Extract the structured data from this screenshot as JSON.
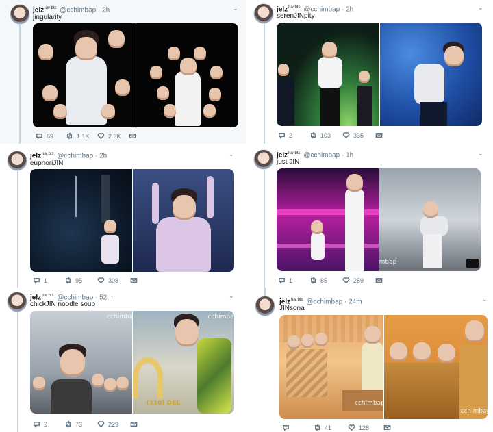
{
  "tweets": [
    {
      "name": "jelz",
      "badge": "luv bts",
      "handle": "@cchimbap",
      "dot": "·",
      "time": "2h",
      "text": "jingularity",
      "replies": "69",
      "retweets": "1.1K",
      "likes": "2.3K"
    },
    {
      "name": "jelz",
      "badge": "luv bts",
      "handle": "@cchimbap",
      "dot": "·",
      "time": "2h",
      "text": "serenJINpity",
      "replies": "2",
      "retweets": "103",
      "likes": "335"
    },
    {
      "name": "jelz",
      "badge": "luv bts",
      "handle": "@cchimbap",
      "dot": "·",
      "time": "2h",
      "text": "euphoriJIN",
      "replies": "1",
      "retweets": "95",
      "likes": "308"
    },
    {
      "name": "jelz",
      "badge": "luv bts",
      "handle": "@cchimbap",
      "dot": "·",
      "time": "1h",
      "text": "just JIN",
      "replies": "1",
      "retweets": "85",
      "likes": "259"
    },
    {
      "name": "jelz",
      "badge": "luv bts",
      "handle": "@cchimbap",
      "dot": "·",
      "time": "52m",
      "text": "chickJIN noodle soup",
      "replies": "2",
      "retweets": "73",
      "likes": "229"
    },
    {
      "name": "jelz",
      "badge": "luv bts",
      "handle": "@cchimbap",
      "dot": "·",
      "time": "24m",
      "text": "JINsona",
      "replies": "",
      "retweets": "41",
      "likes": "128"
    }
  ],
  "watermarks": {
    "t5_left": "cchimbap",
    "t5_right": "cchimbap",
    "t5_sign": "(310) DEL",
    "t6_left": "cchimbap",
    "t6_right": "cchimbap",
    "t4_right": "cchimbap"
  },
  "icons": {
    "reply": "reply-icon",
    "retweet": "retweet-icon",
    "like": "heart-icon",
    "dm": "envelope-icon",
    "caret": "chevron-down-icon"
  },
  "colors": {
    "thread_line": "#c6d4e0",
    "meta": "#657786",
    "highlight_bg": "#f5f8fa"
  }
}
